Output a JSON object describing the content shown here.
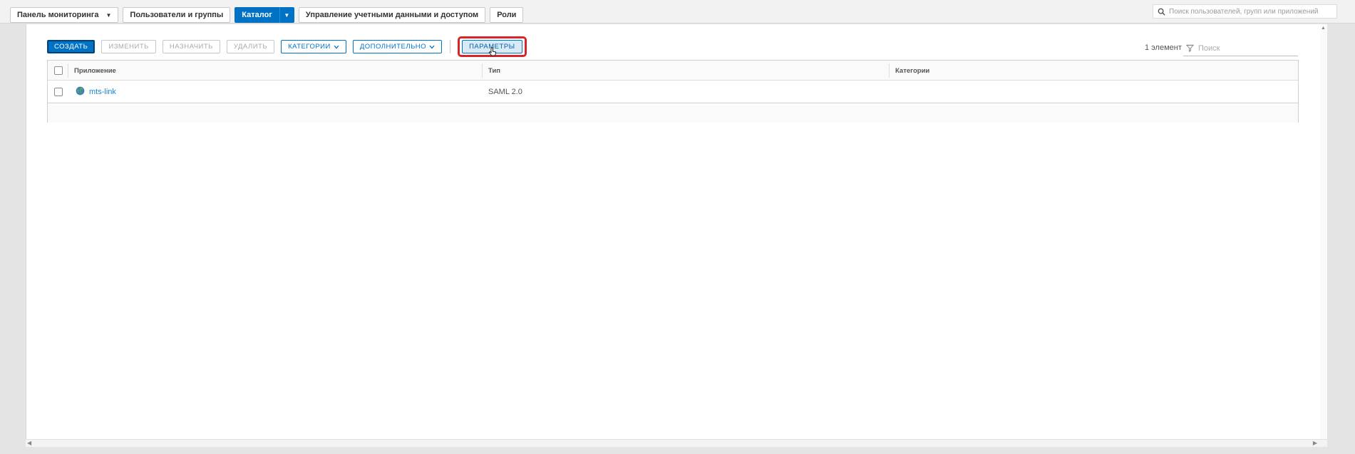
{
  "nav": {
    "tabs": [
      {
        "label": "Панель мониторинга"
      },
      {
        "label": "Пользователи и группы"
      },
      {
        "label": "Каталог"
      },
      {
        "label": "Управление учетными данными и доступом"
      },
      {
        "label": "Роли"
      }
    ],
    "search_placeholder": "Поиск пользователей, групп или приложений"
  },
  "toolbar": {
    "create": "СОЗДАТЬ",
    "edit": "ИЗМЕНИТЬ",
    "assign": "НАЗНАЧИТЬ",
    "delete": "УДАЛИТЬ",
    "categories": "КАТЕГОРИИ",
    "more": "ДОПОЛНИТЕЛЬНО",
    "params": "ПАРАМЕТРЫ"
  },
  "list": {
    "count": "1 элемент",
    "filter_placeholder": "Поиск",
    "columns": [
      "Приложение",
      "Тип",
      "Категории"
    ],
    "rows": [
      {
        "app": "mts-link",
        "type": "SAML 2.0",
        "categories": ""
      }
    ]
  },
  "colors": {
    "accent": "#0072c6",
    "highlight": "#d7262b"
  }
}
